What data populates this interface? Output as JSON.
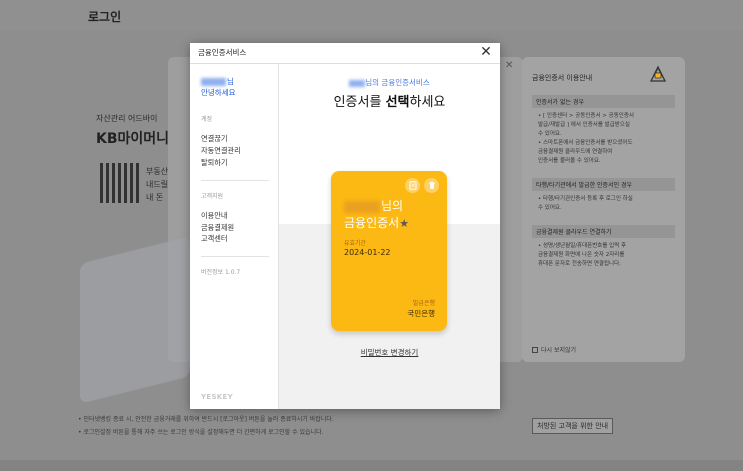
{
  "background": {
    "login_title": "로그인",
    "promo_small": "자산관리 어드바이",
    "promo_big": "KB마이머니",
    "qr_text": [
      "부동산",
      "내드릴",
      "내 돈"
    ],
    "footer_lines": [
      "• 인터넷뱅킹 종료 시, 안전한 금융거래를 위하여 반드시 [로그아웃] 버튼을 눌러 종료하시기 바랍니다.",
      "• 로그인설정 버튼을 통해 자주 쓰는 로그인 방식을 설정해두면 더 간편하게 로그인할 수 있습니다."
    ],
    "footer_button": "처방된 고객을 위한 안내"
  },
  "info_panel": {
    "title": "금융인증서 이용안내",
    "sections": [
      {
        "title": "인증서가 없는 경우",
        "text": [
          "• [ 인증센터 > 공동인증서 > 공동인증서",
          "발급/재발급 ] 에서 인증서를 발급받으실",
          "수 있어요.",
          "• 스마트폰에서 금융인증서를 받으셨어도",
          "금융결제원 클라우드에 연결하여",
          "인증서를 불러올 수 있어요."
        ]
      },
      {
        "title": "타행/타기관에서 발급한 인증서인 경우",
        "text": [
          "• 타행/타기관인증서 등록 후 로그인 하실",
          "수 있어요."
        ]
      },
      {
        "title": "금융결제원 클라우드 연결하기",
        "text": [
          "• 성명/생년월일/휴대폰번호를 입력 후",
          "금융결제원 화면에 나온 숫자 2자리를",
          "휴대폰 문자로 전송하면 연결됩니다."
        ]
      }
    ],
    "checkbox_label": "다시 보지않기"
  },
  "modal": {
    "title": "금융인증서비스",
    "sidebar": {
      "name_suffix": "님",
      "greeting": "안녕하세요",
      "group_account": "계정",
      "account_items": [
        "연결끊기",
        "자동연결관리",
        "탈퇴하기"
      ],
      "group_support": "고객지원",
      "support_items": [
        "이용안내",
        "금융결제원",
        "고객센터"
      ],
      "version": "버전정보 1.0.7",
      "logo": "YESKEY"
    },
    "content": {
      "subtitle_suffix": "님의 금융인증서비스",
      "heading_pre": "인증서를 ",
      "heading_bold": "선택",
      "heading_post": "하세요",
      "card": {
        "owner_suffix": "님의",
        "type": "금융인증서",
        "expiry_label": "유효기간",
        "expiry": "2024-01-22",
        "issuer_label": "발급은행",
        "issuer": "국민은행",
        "color": "#fdb913"
      },
      "change_password": "비밀번호 변경하기"
    }
  }
}
